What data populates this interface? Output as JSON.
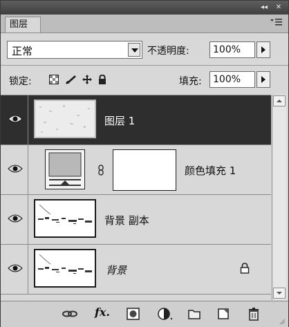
{
  "titlebar": {
    "collapse_icon": "collapse-arrows-icon",
    "close_icon": "close-icon"
  },
  "tab": {
    "label": "图层"
  },
  "panel_menu_icon": "panel-menu-icon",
  "blend": {
    "mode": "正常",
    "opacity_label": "不透明度:",
    "opacity_value": "100%"
  },
  "lock": {
    "label": "锁定:",
    "fill_label": "填充:",
    "fill_value": "100%",
    "icons": [
      "lock-transparent-pixels-icon",
      "lock-image-pixels-icon",
      "lock-position-icon",
      "lock-all-icon"
    ]
  },
  "layers": [
    {
      "name": "图层 1",
      "visible": true,
      "selected": true,
      "thumbnail": "texture"
    },
    {
      "name": "颜色填充 1",
      "visible": true,
      "selected": false,
      "thumbnail": "fill-with-mask"
    },
    {
      "name": "背景 副本",
      "visible": true,
      "selected": false,
      "thumbnail": "sketch"
    },
    {
      "name": "背景",
      "visible": true,
      "selected": false,
      "thumbnail": "sketch",
      "locked": true,
      "italic": true
    }
  ],
  "footer_icons": [
    "link-layers-icon",
    "layer-style-fx-icon",
    "add-mask-icon",
    "adjustment-layer-icon",
    "new-group-icon",
    "new-layer-icon",
    "delete-layer-icon"
  ],
  "footer": {
    "fx_label": "fx."
  },
  "colors": {
    "selected_row": "#2e2e2e",
    "panel_bg": "#d8d8d8",
    "titlebar": "#4a4a4a"
  }
}
